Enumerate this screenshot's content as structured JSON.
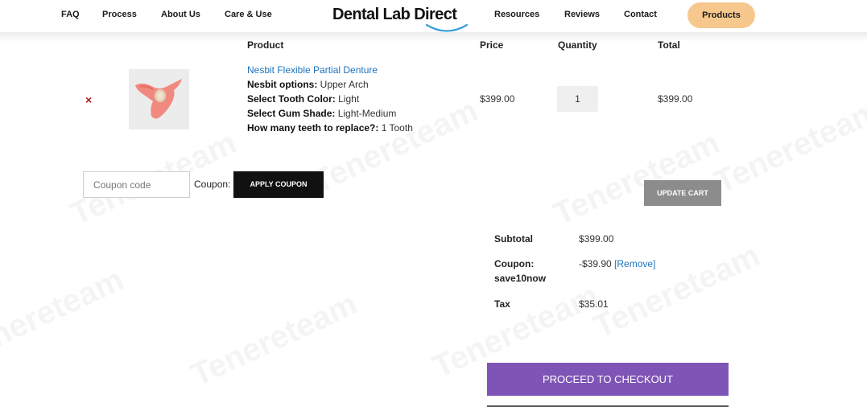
{
  "nav": {
    "faq": "FAQ",
    "process": "Process",
    "about": "About Us",
    "care": "Care & Use",
    "logo": "Dental Lab Direct",
    "resources": "Resources",
    "reviews": "Reviews",
    "contact": "Contact",
    "products": "Products"
  },
  "table_headers": {
    "product": "Product",
    "price": "Price",
    "quantity": "Quantity",
    "total": "Total"
  },
  "cart_item": {
    "remove": "×",
    "name": "Nesbit Flexible Partial Denture",
    "options": [
      {
        "label": "Nesbit options:",
        "value": "Upper Arch"
      },
      {
        "label": "Select Tooth Color:",
        "value": "Light"
      },
      {
        "label": "Select Gum Shade:",
        "value": "Light-Medium"
      },
      {
        "label": "How many teeth to replace?:",
        "value": "1 Tooth"
      }
    ],
    "price": "$399.00",
    "quantity": "1",
    "total": "$399.00"
  },
  "coupon": {
    "placeholder": "Coupon code",
    "label": "Coupon:",
    "apply": "APPLY COUPON",
    "update_cart": "UPDATE CART"
  },
  "totals": {
    "subtotal_label": "Subtotal",
    "subtotal_value": "$399.00",
    "coupon_label_1": "Coupon:",
    "coupon_label_2": "save10now",
    "coupon_value": "-$39.90",
    "coupon_remove": "[Remove]",
    "tax_label": "Tax",
    "tax_value": "$35.01"
  },
  "checkout": {
    "proceed": "PROCEED TO CHECKOUT"
  },
  "colors": {
    "accent_purple": "#7e55b6",
    "products_pill": "#f6c88d",
    "link_blue": "#1e73be",
    "remove_red": "#b0161e"
  },
  "watermark": "Tenereteam"
}
